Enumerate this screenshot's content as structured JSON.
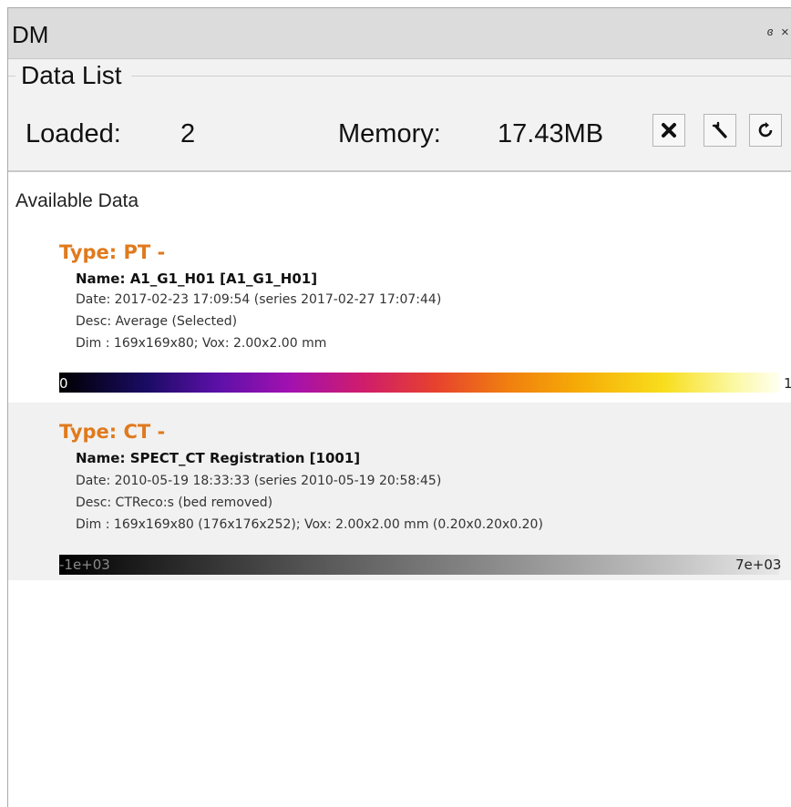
{
  "window": {
    "title": "DM",
    "float_glyph": "ɞ",
    "close_glyph": "×"
  },
  "panel": {
    "title": "Data List",
    "loaded_label": "Loaded:",
    "loaded_value": "2",
    "memory_label": "Memory:",
    "memory_value": "17.43MB",
    "buttons": [
      {
        "name": "remove",
        "icon": "x-icon"
      },
      {
        "name": "settings",
        "icon": "wrench-icon"
      },
      {
        "name": "refresh",
        "icon": "refresh-icon"
      }
    ]
  },
  "available": {
    "title": "Available Data",
    "entries": [
      {
        "type": "Type: PT -",
        "name": "Name: A1_G1_H01 [A1_G1_H01]",
        "date": "Date: 2017-02-23 17:09:54 (series 2017-02-27 17:07:44)",
        "desc": "Desc: Average (Selected)",
        "dim": "Dim : 169x169x80; Vox: 2.00x2.00 mm",
        "cbar_min": "0",
        "cbar_max": "1",
        "colormap": "hot-metal"
      },
      {
        "type": "Type: CT -",
        "name": "Name: SPECT_CT Registration [1001]",
        "date": "Date: 2010-05-19 18:33:33 (series 2010-05-19 20:58:45)",
        "desc": "Desc: CTReco:s (bed removed)",
        "dim": "Dim : 169x169x80 (176x176x252); Vox: 2.00x2.00 mm (0.20x0.20x0.20)",
        "cbar_min": "-1e+03",
        "cbar_max": "7e+03",
        "colormap": "grayscale"
      }
    ]
  },
  "colors": {
    "type_label": "#e07a1d",
    "title_bar": "#dcdcdc",
    "panel_bg": "#f2f2f2"
  }
}
